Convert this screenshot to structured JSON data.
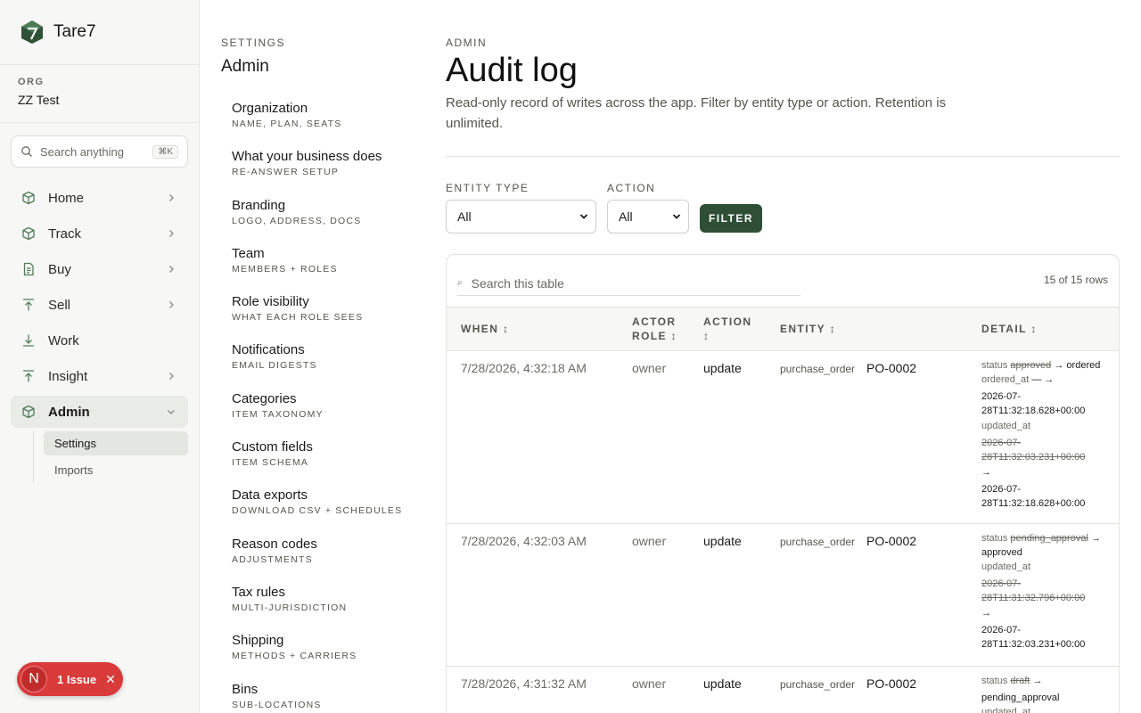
{
  "brand": {
    "name": "Tare7"
  },
  "org": {
    "label": "ORG",
    "name": "ZZ Test"
  },
  "search": {
    "placeholder": "Search anything",
    "shortcut": "⌘K"
  },
  "nav": [
    {
      "label": "Home",
      "icon": "box-icon",
      "has_chevron": true
    },
    {
      "label": "Track",
      "icon": "box-icon",
      "has_chevron": true
    },
    {
      "label": "Buy",
      "icon": "document-icon",
      "has_chevron": true
    },
    {
      "label": "Sell",
      "icon": "upload-icon",
      "has_chevron": true
    },
    {
      "label": "Work",
      "icon": "download-icon",
      "has_chevron": false
    },
    {
      "label": "Insight",
      "icon": "upload-icon",
      "has_chevron": true
    },
    {
      "label": "Admin",
      "icon": "box-icon",
      "has_chevron": true,
      "expanded": true
    }
  ],
  "subnav": [
    {
      "label": "Settings",
      "active": true
    },
    {
      "label": "Imports",
      "active": false
    }
  ],
  "issue": {
    "letter": "N",
    "text": "1 Issue"
  },
  "settings": {
    "kicker": "SETTINGS",
    "title": "Admin",
    "items": [
      {
        "name": "Organization",
        "desc": "NAME, PLAN, SEATS"
      },
      {
        "name": "What your business does",
        "desc": "RE-ANSWER SETUP"
      },
      {
        "name": "Branding",
        "desc": "LOGO, ADDRESS, DOCS"
      },
      {
        "name": "Team",
        "desc": "MEMBERS + ROLES"
      },
      {
        "name": "Role visibility",
        "desc": "WHAT EACH ROLE SEES"
      },
      {
        "name": "Notifications",
        "desc": "EMAIL DIGESTS"
      },
      {
        "name": "Categories",
        "desc": "ITEM TAXONOMY"
      },
      {
        "name": "Custom fields",
        "desc": "ITEM SCHEMA"
      },
      {
        "name": "Data exports",
        "desc": "DOWNLOAD CSV + SCHEDULES"
      },
      {
        "name": "Reason codes",
        "desc": "ADJUSTMENTS"
      },
      {
        "name": "Tax rules",
        "desc": "MULTI-JURISDICTION"
      },
      {
        "name": "Shipping",
        "desc": "METHODS + CARRIERS"
      },
      {
        "name": "Bins",
        "desc": "SUB-LOCATIONS"
      }
    ]
  },
  "main": {
    "kicker": "ADMIN",
    "title": "Audit log",
    "description": "Read-only record of writes across the app. Filter by entity type or action. Retention is unlimited.",
    "filters": {
      "entity_type_label": "ENTITY TYPE",
      "entity_type_value": "All",
      "action_label": "ACTION",
      "action_value": "All",
      "button": "FILTER"
    },
    "table": {
      "search_placeholder": "Search this table",
      "row_count": "15 of 15 rows",
      "columns": {
        "when": "WHEN ↕",
        "actor_role_1": "ACTOR",
        "actor_role_2": "ROLE ↕",
        "action_1": "ACTION",
        "action_2": "↕",
        "entity": "ENTITY ↕",
        "detail": "DETAIL ↕"
      },
      "rows": [
        {
          "when": "7/28/2026, 4:32:18 AM",
          "role": "owner",
          "action": "update",
          "entity_type": "purchase_order",
          "entity_id": "PO-0002"
        },
        {
          "when": "7/28/2026, 4:32:03 AM",
          "role": "owner",
          "action": "update",
          "entity_type": "purchase_order",
          "entity_id": "PO-0002"
        },
        {
          "when": "7/28/2026, 4:31:32 AM",
          "role": "owner",
          "action": "update",
          "entity_type": "purchase_order",
          "entity_id": "PO-0002"
        }
      ],
      "details": {
        "r1": {
          "status_key": "status",
          "status_old": "approved",
          "arrow": "→",
          "status_new": "ordered",
          "ordered_key": "ordered_at",
          "ordered_old": "—",
          "ordered_new": "2026-07-28T11:32:18.628+00:00",
          "updated_key": "updated_at",
          "updated_old": "2026-07-28T11:32:03.231+00:00",
          "updated_new": "2026-07-28T11:32:18.628+00:00"
        },
        "r2": {
          "status_key": "status",
          "status_old": "pending_approval",
          "arrow": "→",
          "status_new": "approved",
          "updated_key": "updated_at",
          "updated_old": "2026-07-28T11:31:32.796+00:00",
          "updated_new": "2026-07-28T11:32:03.231+00:00"
        },
        "r3": {
          "status_key": "status",
          "status_old": "draft",
          "arrow": "→",
          "status_new": "pending_approval",
          "updated_key": "updated_at"
        }
      }
    }
  }
}
